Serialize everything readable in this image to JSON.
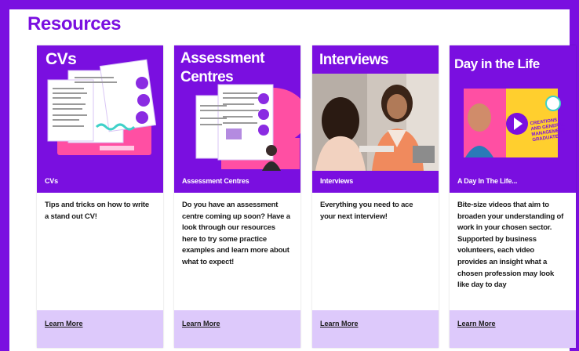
{
  "section": {
    "title": "Resources"
  },
  "colors": {
    "brand": "#7a0fe0",
    "footer": "#ddc9fb",
    "pink": "#ff4fa3"
  },
  "cards": [
    {
      "image_title": "CVs",
      "name": "CVs",
      "description": "Tips and tricks on how to write a stand out CV!",
      "link": "Learn More"
    },
    {
      "image_title_1": "Assessment",
      "image_title_2": "Centres",
      "name": "Assessment Centres",
      "description": "Do you have an assessment centre coming up soon? Have a look through our resources here to try some practice examples and learn more about what to expect!",
      "link": "Learn More"
    },
    {
      "image_title": "Interviews",
      "name": "Interviews",
      "description": "Everything you need to ace your next interview!",
      "link": "Learn More"
    },
    {
      "image_title": "Day in the Life",
      "name": "A Day In The Life...",
      "description": "Bite-size videos that aim to broaden your understanding of work in your chosen sector. Supported by business volunteers, each video provides an insight what a chosen profession may look like day to day",
      "link": "Learn More",
      "badge_text": "CREATIONS AND GENERAL MANAGEMENT GRADUATE"
    }
  ]
}
